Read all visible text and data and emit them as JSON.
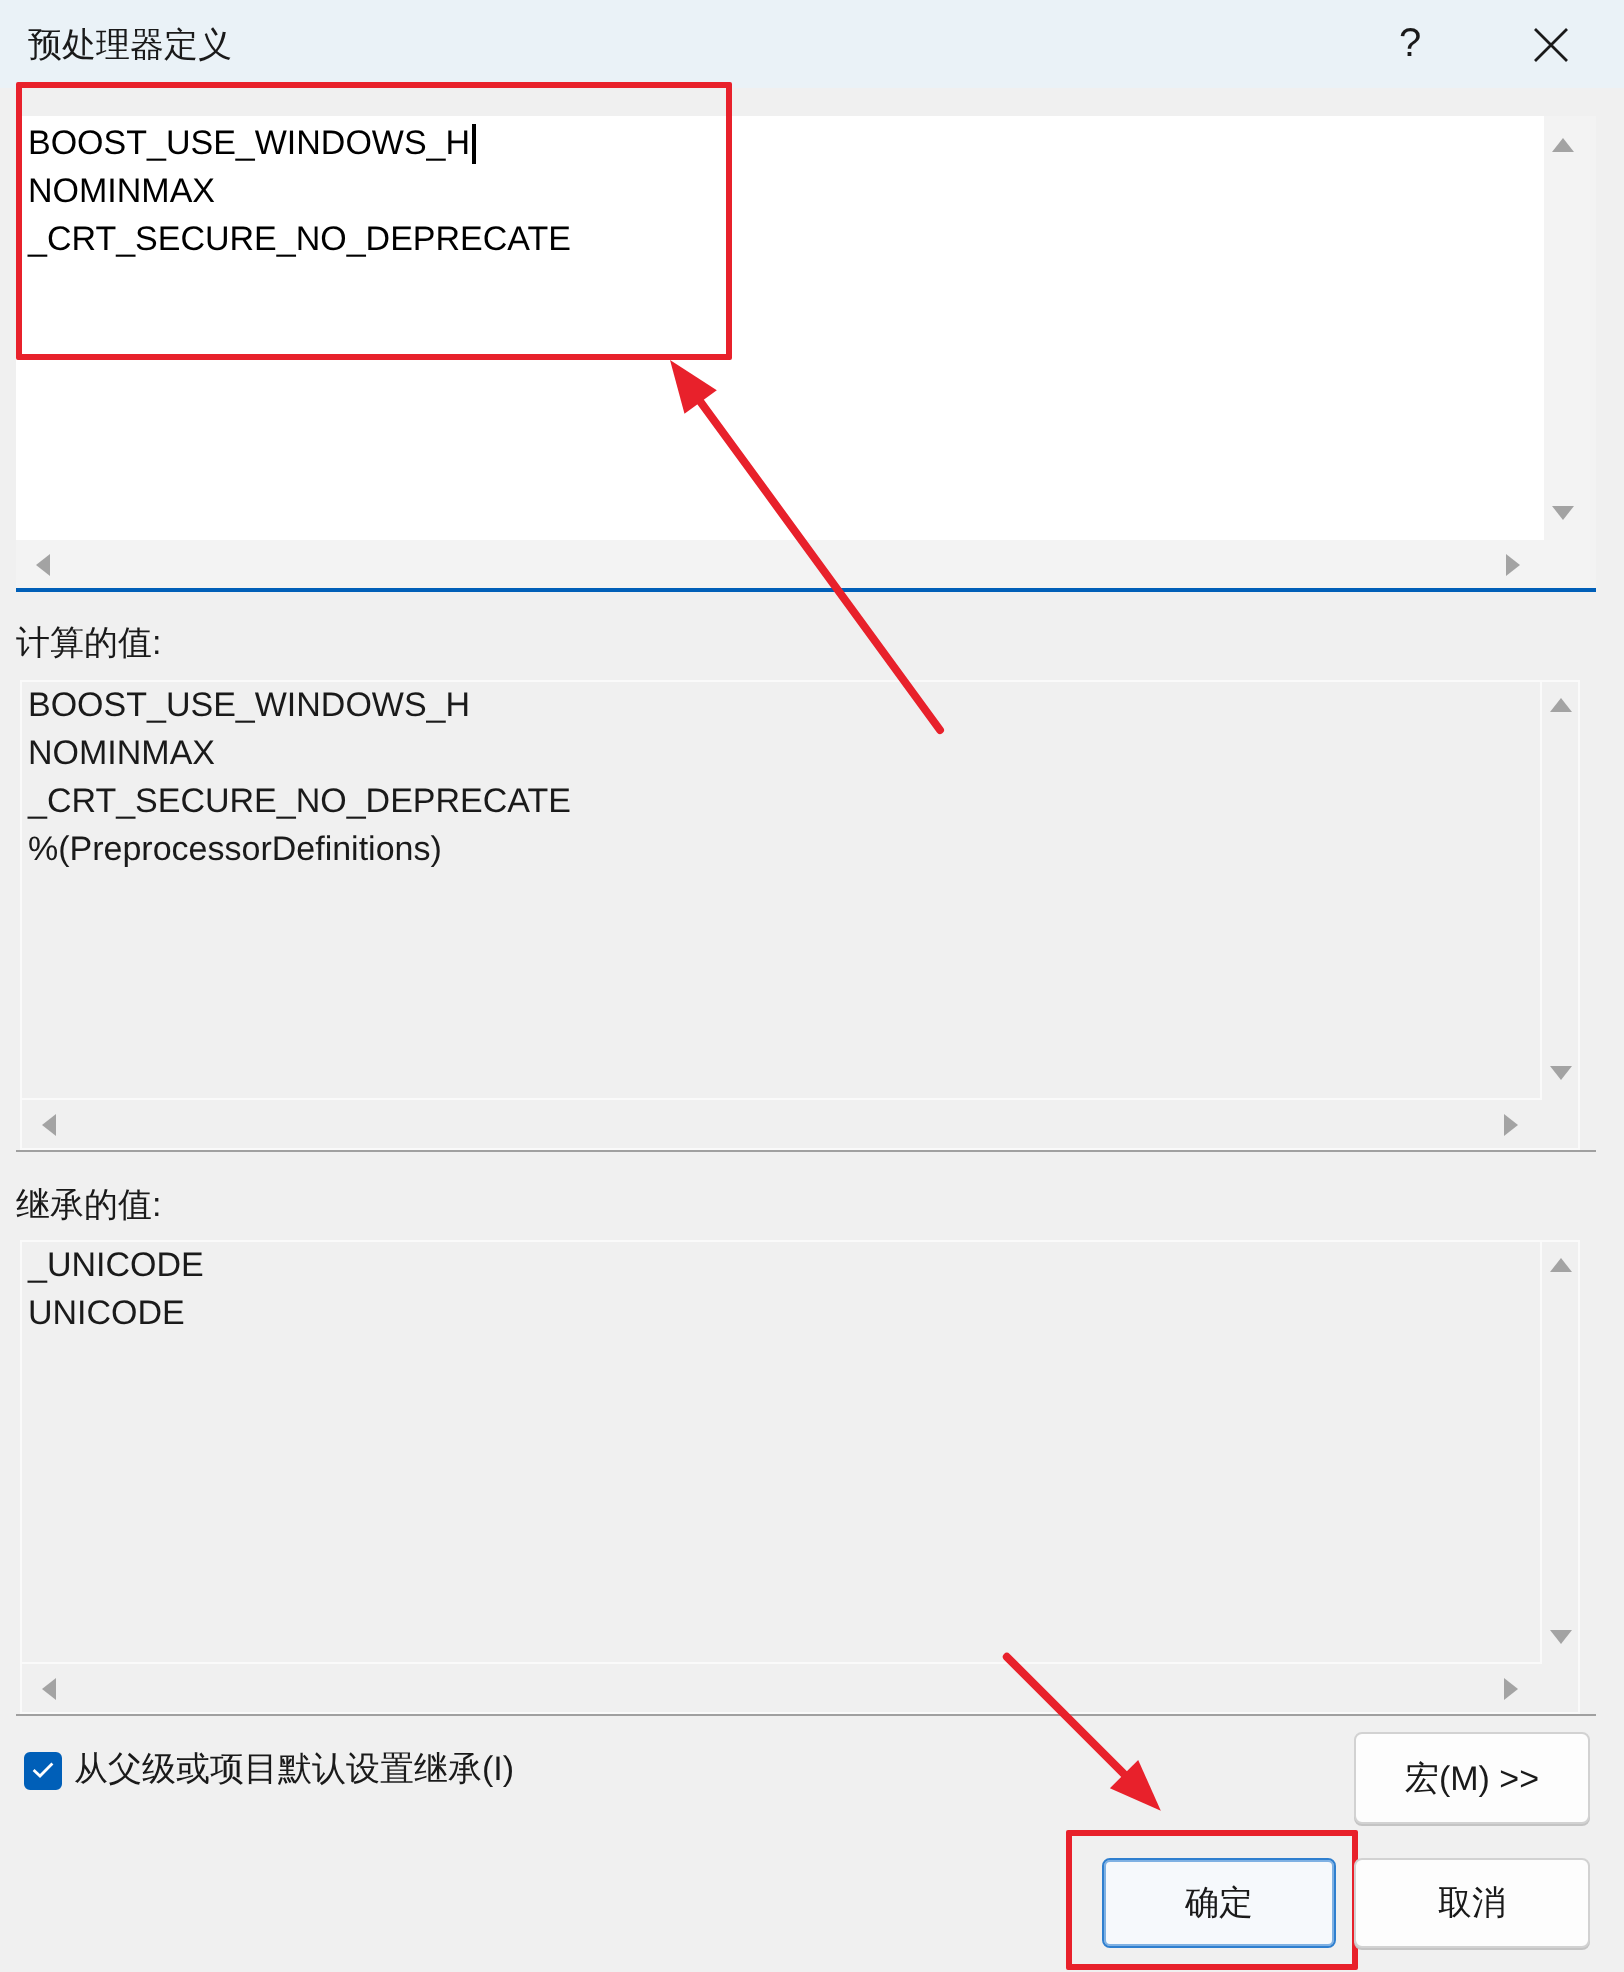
{
  "window": {
    "title": "预处理器定义",
    "help_label": "?"
  },
  "editor": {
    "lines": [
      {
        "text": "BOOST_USE_WINDOWS_H",
        "caret": true
      },
      {
        "text": "NOMINMAX",
        "caret": false
      },
      {
        "text": "_CRT_SECURE_NO_DEPRECATE",
        "caret": false
      }
    ],
    "focused": true,
    "highlight_box": true,
    "highlight_arrow": true
  },
  "computed": {
    "label": "计算的值:",
    "lines": [
      "BOOST_USE_WINDOWS_H",
      "NOMINMAX",
      "_CRT_SECURE_NO_DEPRECATE",
      "%(PreprocessorDefinitions)"
    ]
  },
  "inherited": {
    "label": "继承的值:",
    "lines": [
      "_UNICODE",
      "UNICODE"
    ]
  },
  "inherit_checkbox": {
    "label": "从父级或项目默认设置继承(I)",
    "checked": true
  },
  "macros_button": {
    "label": "宏(M) >>"
  },
  "dialog_buttons": [
    {
      "label": "确定",
      "default": true,
      "highlight_box": true,
      "highlight_arrow": true
    },
    {
      "label": "取消",
      "default": false,
      "highlight_box": false,
      "highlight_arrow": false
    }
  ]
}
